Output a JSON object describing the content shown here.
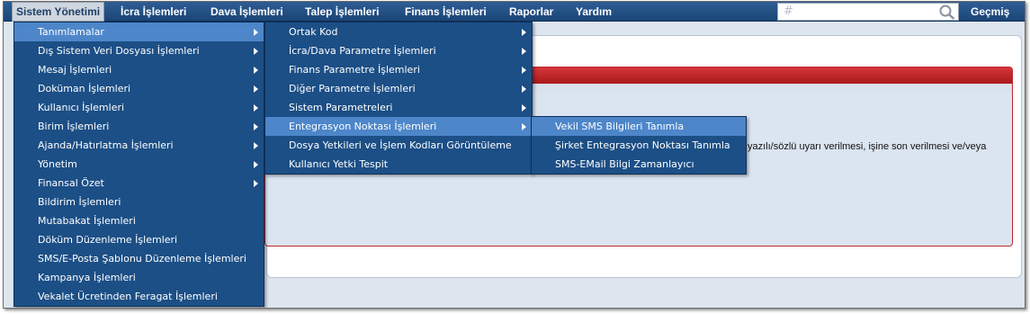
{
  "menubar": {
    "items": [
      {
        "label": "Sistem Yönetimi",
        "active": true
      },
      {
        "label": "İcra İşlemleri"
      },
      {
        "label": "Dava İşlemleri"
      },
      {
        "label": "Talep İşlemleri"
      },
      {
        "label": "Finans İşlemleri"
      },
      {
        "label": "Raporlar"
      },
      {
        "label": "Yardım"
      }
    ],
    "search_placeholder": "",
    "search_icon": "magnifier-icon",
    "history_label": "Geçmiş"
  },
  "menu_level1": [
    {
      "label": "Tanımlamalar",
      "submenu": true,
      "highlighted": true
    },
    {
      "label": "Dış Sistem Veri Dosyası İşlemleri",
      "submenu": true
    },
    {
      "label": "Mesaj İşlemleri",
      "submenu": true
    },
    {
      "label": "Doküman İşlemleri",
      "submenu": true
    },
    {
      "label": "Kullanıcı İşlemleri",
      "submenu": true
    },
    {
      "label": "Birim İşlemleri",
      "submenu": true
    },
    {
      "label": "Ajanda/Hatırlatma İşlemleri",
      "submenu": true
    },
    {
      "label": "Yönetim",
      "submenu": true
    },
    {
      "label": "Finansal Özet",
      "submenu": true
    },
    {
      "label": "Bildirim İşlemleri",
      "submenu": false
    },
    {
      "label": "Mutabakat İşlemleri",
      "submenu": false
    },
    {
      "label": "Döküm Düzenleme İşlemleri",
      "submenu": false
    },
    {
      "label": "SMS/E-Posta Şablonu Düzenleme İşlemleri",
      "submenu": false
    },
    {
      "label": "Kampanya İşlemleri",
      "submenu": false
    },
    {
      "label": "Vekalet Ücretinden Feragat İşlemleri",
      "submenu": false
    }
  ],
  "menu_level2": [
    {
      "label": "Ortak Kod",
      "submenu": true
    },
    {
      "label": "İcra/Dava Parametre İşlemleri",
      "submenu": true
    },
    {
      "label": "Finans Parametre İşlemleri",
      "submenu": true
    },
    {
      "label": "Diğer Parametre İşlemleri",
      "submenu": true
    },
    {
      "label": "Sistem Parametreleri",
      "submenu": true
    },
    {
      "label": "Entegrasyon Noktası İşlemleri",
      "submenu": true,
      "highlighted": true
    },
    {
      "label": "Dosya Yetkileri ve İşlem Kodları Görüntüleme",
      "submenu": false
    },
    {
      "label": "Kullanıcı Yetki Tespit",
      "submenu": false
    }
  ],
  "menu_level3": [
    {
      "label": "Vekil SMS Bilgileri Tanımla",
      "highlighted": true
    },
    {
      "label": "Şirket Entegrasyon Noktası Tanımla"
    },
    {
      "label": "SMS-EMail Bilgi Zamanlayıcı"
    }
  ],
  "page": {
    "warning_fragment": "yazılı/sözlü uyarı verilmesi, işine son verilmesi ve/veya"
  },
  "colors": {
    "menubar": "#1b4577",
    "menu_bg": "#1c4f86",
    "menu_highlight": "#4d86c9",
    "panel_header": "#c0262b"
  }
}
